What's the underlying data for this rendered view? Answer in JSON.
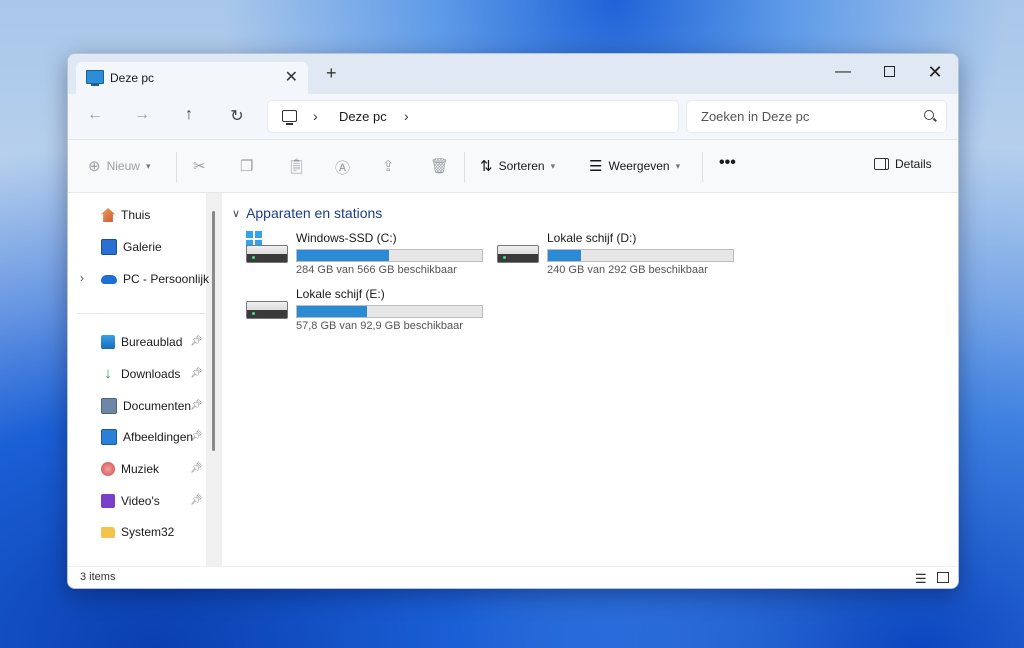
{
  "window": {
    "tab_title": "Deze pc",
    "tab_close": "✕",
    "new_tab": "+",
    "minimize": "—",
    "close": "✕"
  },
  "nav": {
    "back": "←",
    "forward": "→",
    "up": "↑",
    "refresh": "↻",
    "breadcrumb": "Deze pc",
    "sep": "›",
    "search_placeholder": "Zoeken in Deze pc"
  },
  "toolbar": {
    "new_label": "Nieuw",
    "sort_label": "Sorteren",
    "view_label": "Weergeven",
    "more": "•••",
    "details_label": "Details"
  },
  "sidebar": {
    "items": [
      {
        "label": "Thuis"
      },
      {
        "label": "Galerie"
      },
      {
        "label": "PC - Persoonlijk"
      },
      {
        "label": "Bureaublad"
      },
      {
        "label": "Downloads"
      },
      {
        "label": "Documenten"
      },
      {
        "label": "Afbeeldingen"
      },
      {
        "label": "Muziek"
      },
      {
        "label": "Video's"
      },
      {
        "label": "System32"
      }
    ]
  },
  "main": {
    "group_title": "Apparaten en stations",
    "drives": [
      {
        "name": "Windows-SSD (C:)",
        "free": "284 GB van 566 GB beschikbaar",
        "used_fraction": 0.498
      },
      {
        "name": "Lokale schijf (D:)",
        "free": "240 GB van 292 GB beschikbaar",
        "used_fraction": 0.178
      },
      {
        "name": "Lokale schijf (E:)",
        "free": "57,8 GB van 92,9 GB beschikbaar",
        "used_fraction": 0.378
      }
    ]
  },
  "status": {
    "count": "3 items"
  },
  "colors": {
    "accent": "#2a8ad4",
    "group_title": "#1f3c88"
  }
}
